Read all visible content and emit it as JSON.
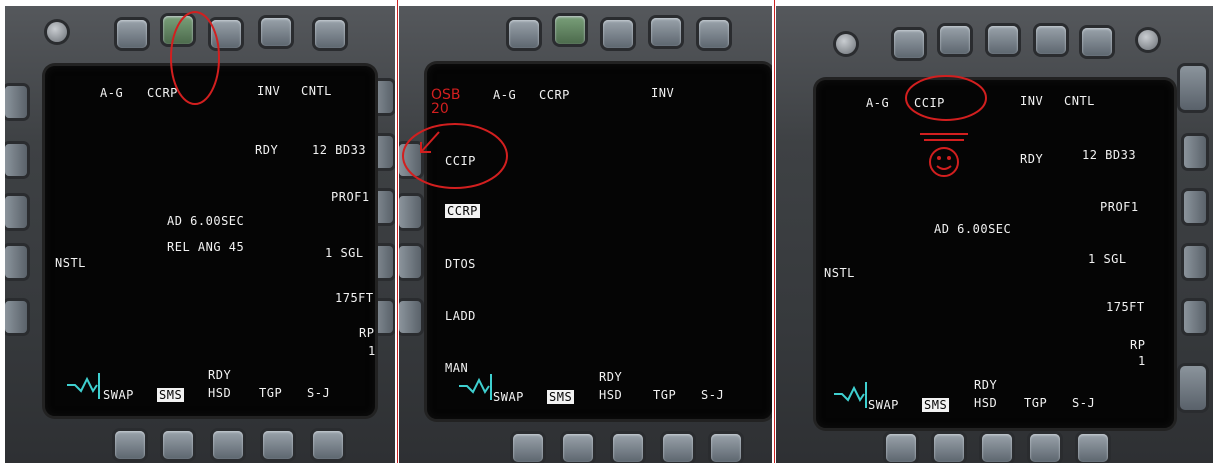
{
  "panels": [
    {
      "osb_top_left": "A-G",
      "mode": "CCRP",
      "inv": "INV",
      "cntl": "CNTL",
      "rdy": "RDY",
      "qty_type": "12 BD33",
      "prof": "PROF1",
      "ad": "AD 6.00SEC",
      "rel_ang": "REL ANG 45",
      "nstl": "NSTL",
      "sgl": "1  SGL",
      "alt": "175FT",
      "rp": "RP",
      "rp_val": "1",
      "bottom": {
        "swap": "SWAP",
        "sms": "SMS",
        "rdy": "RDY",
        "hsd": "HSD",
        "tgp": "TGP",
        "sj": "S-J"
      }
    },
    {
      "osb_top_left": "A-G",
      "mode": "CCRP",
      "inv": "INV",
      "modes": [
        "CCIP",
        "CCRP",
        "DTOS",
        "LADD",
        "MAN"
      ],
      "annotation": "OSB\n20",
      "bottom": {
        "swap": "SWAP",
        "sms": "SMS",
        "rdy": "RDY",
        "hsd": "HSD",
        "tgp": "TGP",
        "sj": "S-J"
      }
    },
    {
      "osb_top_left": "A-G",
      "mode": "CCIP",
      "inv": "INV",
      "cntl": "CNTL",
      "rdy": "RDY",
      "qty_type": "12 BD33",
      "prof": "PROF1",
      "ad": "AD 6.00SEC",
      "nstl": "NSTL",
      "sgl": "1  SGL",
      "alt": "175FT",
      "rp": "RP",
      "rp_val": "1",
      "bottom": {
        "swap": "SWAP",
        "sms": "SMS",
        "rdy": "RDY",
        "hsd": "HSD",
        "tgp": "TGP",
        "sj": "S-J"
      }
    }
  ],
  "colors": {
    "annotation": "#d21f1f",
    "text": "#f2f2f2",
    "screen": "#050505",
    "logo": "#3fd0d0"
  }
}
